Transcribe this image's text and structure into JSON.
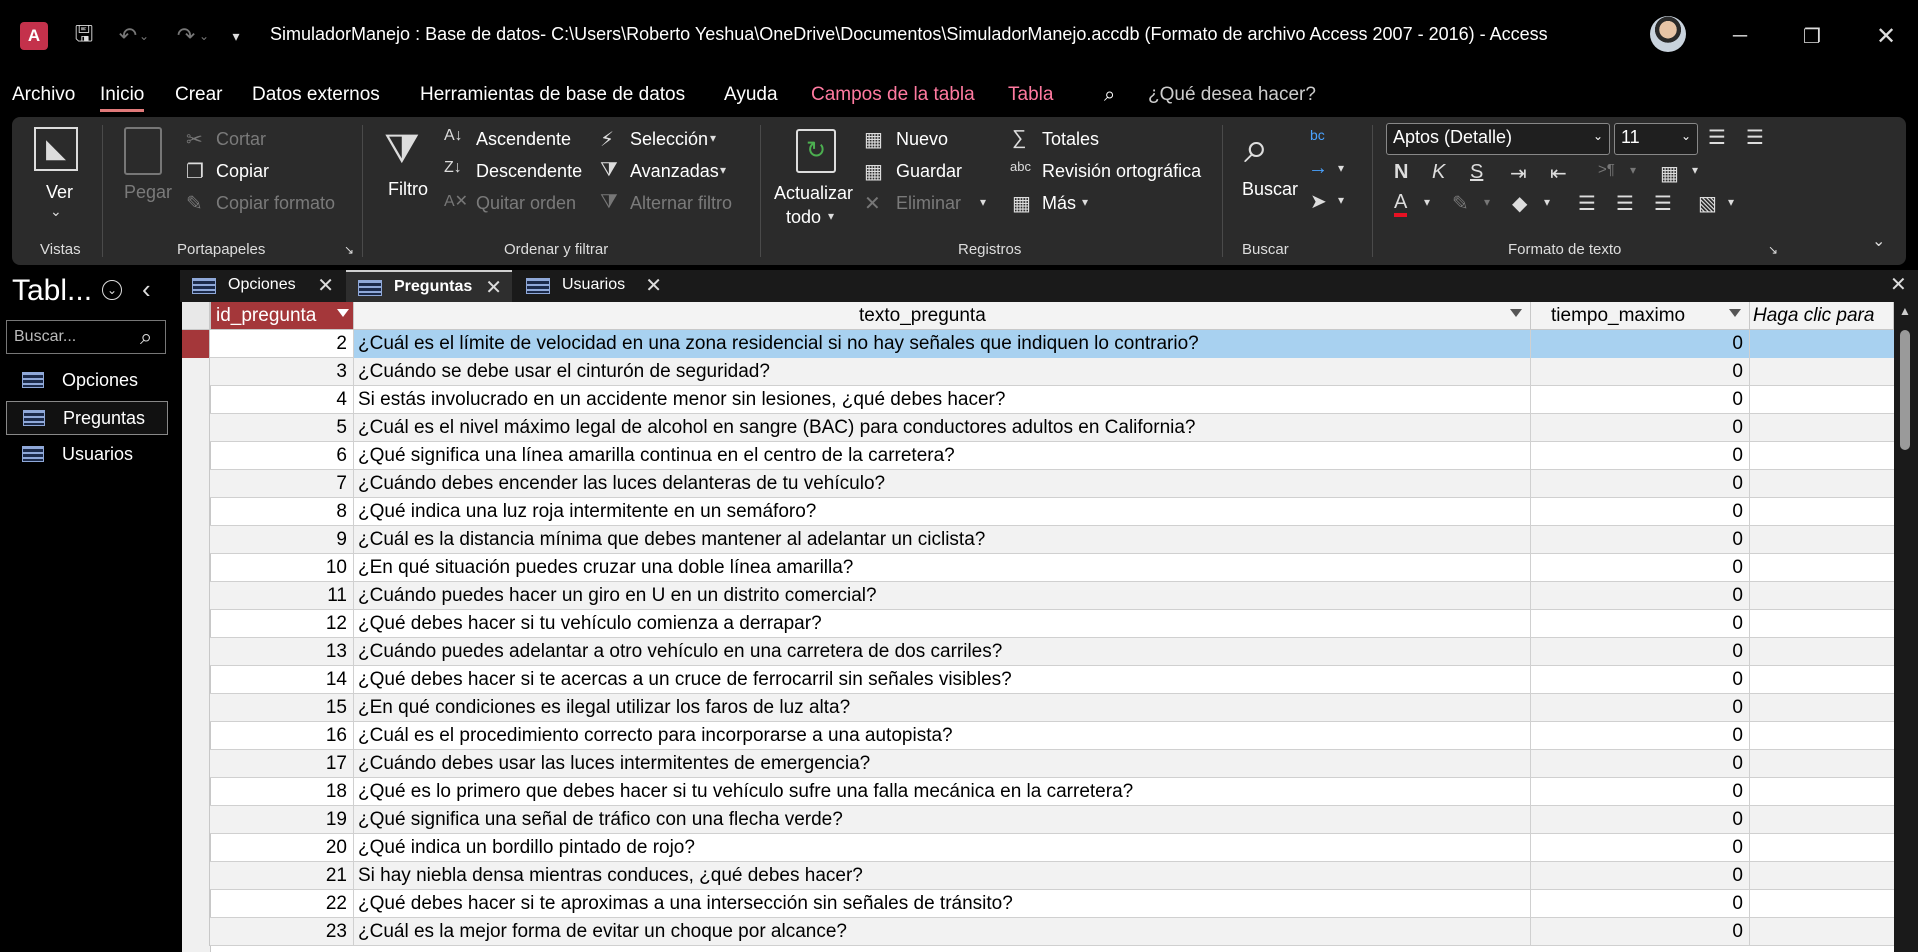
{
  "window": {
    "title": "SimuladorManejo : Base de datos- C:\\Users\\Roberto Yeshua\\OneDrive\\Documentos\\SimuladorManejo.accdb (Formato de archivo Access 2007 - 2016)  -  Access",
    "app_icon_letter": "A"
  },
  "menu": {
    "items": [
      "Archivo",
      "Inicio",
      "Crear",
      "Datos externos",
      "Herramientas de base de datos",
      "Ayuda",
      "Campos de la tabla",
      "Tabla"
    ],
    "tell_me": "¿Qué desea hacer?"
  },
  "ribbon": {
    "vistas": {
      "ver": "Ver",
      "group": "Vistas"
    },
    "portapapeles": {
      "pegar": "Pegar",
      "cortar": "Cortar",
      "copiar": "Copiar",
      "copiar_formato": "Copiar formato",
      "group": "Portapapeles"
    },
    "ordenar": {
      "filtro": "Filtro",
      "ascendente": "Ascendente",
      "descendente": "Descendente",
      "quitar_orden": "Quitar orden",
      "seleccion": "Selección",
      "avanzadas": "Avanzadas",
      "alternar_filtro": "Alternar filtro",
      "group": "Ordenar y filtrar"
    },
    "registros": {
      "actualizar": "Actualizar",
      "todo": "todo",
      "nuevo": "Nuevo",
      "guardar": "Guardar",
      "eliminar": "Eliminar",
      "totales": "Totales",
      "ortografia": "Revisión ortográfica",
      "mas": "Más",
      "group": "Registros"
    },
    "buscar": {
      "buscar": "Buscar",
      "group": "Buscar"
    },
    "formato": {
      "font": "Aptos (Detalle)",
      "size": "11",
      "group": "Formato de texto"
    }
  },
  "nav": {
    "title": "Tabl...",
    "search_placeholder": "Buscar...",
    "items": [
      "Opciones",
      "Preguntas",
      "Usuarios"
    ]
  },
  "tabs": [
    "Opciones",
    "Preguntas",
    "Usuarios"
  ],
  "table": {
    "columns": [
      "id_pregunta",
      "texto_pregunta",
      "tiempo_maximo",
      "Haga clic para"
    ],
    "rows": [
      {
        "id": "2",
        "texto": "¿Cuál es el límite de velocidad en una zona residencial si no hay señales que indiquen lo contrario?",
        "tiempo": "0"
      },
      {
        "id": "3",
        "texto": "¿Cuándo se debe usar el cinturón de seguridad?",
        "tiempo": "0"
      },
      {
        "id": "4",
        "texto": "Si estás involucrado en un accidente menor sin lesiones, ¿qué debes hacer?",
        "tiempo": "0"
      },
      {
        "id": "5",
        "texto": "¿Cuál es el nivel máximo legal de alcohol en sangre (BAC) para conductores adultos en California?",
        "tiempo": "0"
      },
      {
        "id": "6",
        "texto": "¿Qué significa una línea amarilla continua en el centro de la carretera?",
        "tiempo": "0"
      },
      {
        "id": "7",
        "texto": "¿Cuándo debes encender las luces delanteras de tu vehículo?",
        "tiempo": "0"
      },
      {
        "id": "8",
        "texto": "¿Qué indica una luz roja intermitente en un semáforo?",
        "tiempo": "0"
      },
      {
        "id": "9",
        "texto": "¿Cuál es la distancia mínima que debes mantener al adelantar un ciclista?",
        "tiempo": "0"
      },
      {
        "id": "10",
        "texto": "¿En qué situación puedes cruzar una doble línea amarilla?",
        "tiempo": "0"
      },
      {
        "id": "11",
        "texto": "¿Cuándo puedes hacer un giro en U en un distrito comercial?",
        "tiempo": "0"
      },
      {
        "id": "12",
        "texto": "¿Qué debes hacer si tu vehículo comienza a derrapar?",
        "tiempo": "0"
      },
      {
        "id": "13",
        "texto": "¿Cuándo puedes adelantar a otro vehículo en una carretera de dos carriles?",
        "tiempo": "0"
      },
      {
        "id": "14",
        "texto": "¿Qué debes hacer si te acercas a un cruce de ferrocarril sin señales visibles?",
        "tiempo": "0"
      },
      {
        "id": "15",
        "texto": "¿En qué condiciones es ilegal utilizar los faros de luz alta?",
        "tiempo": "0"
      },
      {
        "id": "16",
        "texto": "¿Cuál es el procedimiento correcto para incorporarse a una autopista?",
        "tiempo": "0"
      },
      {
        "id": "17",
        "texto": "¿Cuándo debes usar las luces intermitentes de emergencia?",
        "tiempo": "0"
      },
      {
        "id": "18",
        "texto": "¿Qué es lo primero que debes hacer si tu vehículo sufre una falla mecánica en la carretera?",
        "tiempo": "0"
      },
      {
        "id": "19",
        "texto": "¿Qué significa una señal de tráfico con una flecha verde?",
        "tiempo": "0"
      },
      {
        "id": "20",
        "texto": "¿Qué indica un bordillo pintado de rojo?",
        "tiempo": "0"
      },
      {
        "id": "21",
        "texto": "Si hay niebla densa mientras conduces, ¿qué debes hacer?",
        "tiempo": "0"
      },
      {
        "id": "22",
        "texto": "¿Qué debes hacer si te aproximas a una intersección sin señales de tránsito?",
        "tiempo": "0"
      },
      {
        "id": "23",
        "texto": "¿Cuál es la mejor forma de evitar un choque por alcance?",
        "tiempo": "0"
      }
    ]
  },
  "colors": {
    "accent": "#a4373a",
    "selection": "#a8d1f0",
    "context_tab": "#ff7aa0"
  }
}
